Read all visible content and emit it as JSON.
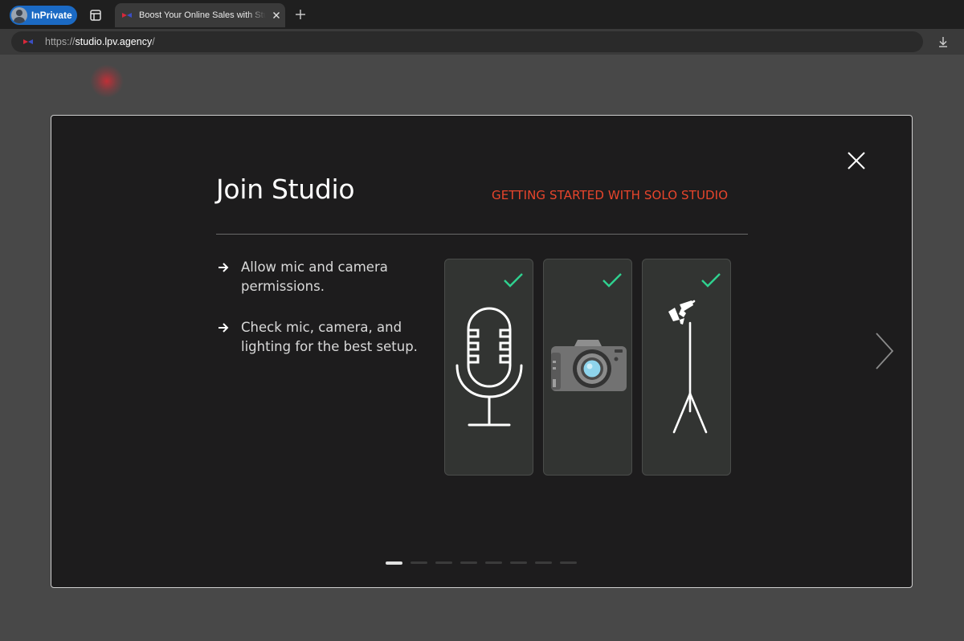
{
  "browser": {
    "profile_label": "InPrivate",
    "tab": {
      "title": "Boost Your Online Sales with Studio",
      "favicon": "lpv-logo-icon"
    },
    "address": {
      "scheme": "https://",
      "host": "studio.lpv.agency",
      "path": "/"
    },
    "icons": [
      "tab-actions-icon",
      "close-icon",
      "new-tab-icon",
      "download-icon"
    ]
  },
  "modal": {
    "title": "Join Studio",
    "subtitle": "GETTING STARTED WITH SOLO STUDIO",
    "steps": [
      {
        "text": "Allow mic and camera permissions.",
        "icon": "arrow-right-icon"
      },
      {
        "text": "Check mic, camera, and lighting for the best setup.",
        "icon": "arrow-right-icon"
      }
    ],
    "cards": [
      {
        "name": "microphone",
        "icon": "microphone-icon",
        "checked": true
      },
      {
        "name": "camera",
        "icon": "camera-icon",
        "checked": true
      },
      {
        "name": "lighting",
        "icon": "studio-light-icon",
        "checked": true
      }
    ],
    "pagination": {
      "total": 8,
      "current": 1
    },
    "colors": {
      "accent": "#e8452c",
      "check": "#2fd18f",
      "modal_bg": "#1d1c1d",
      "page_bg": "#484848"
    }
  }
}
